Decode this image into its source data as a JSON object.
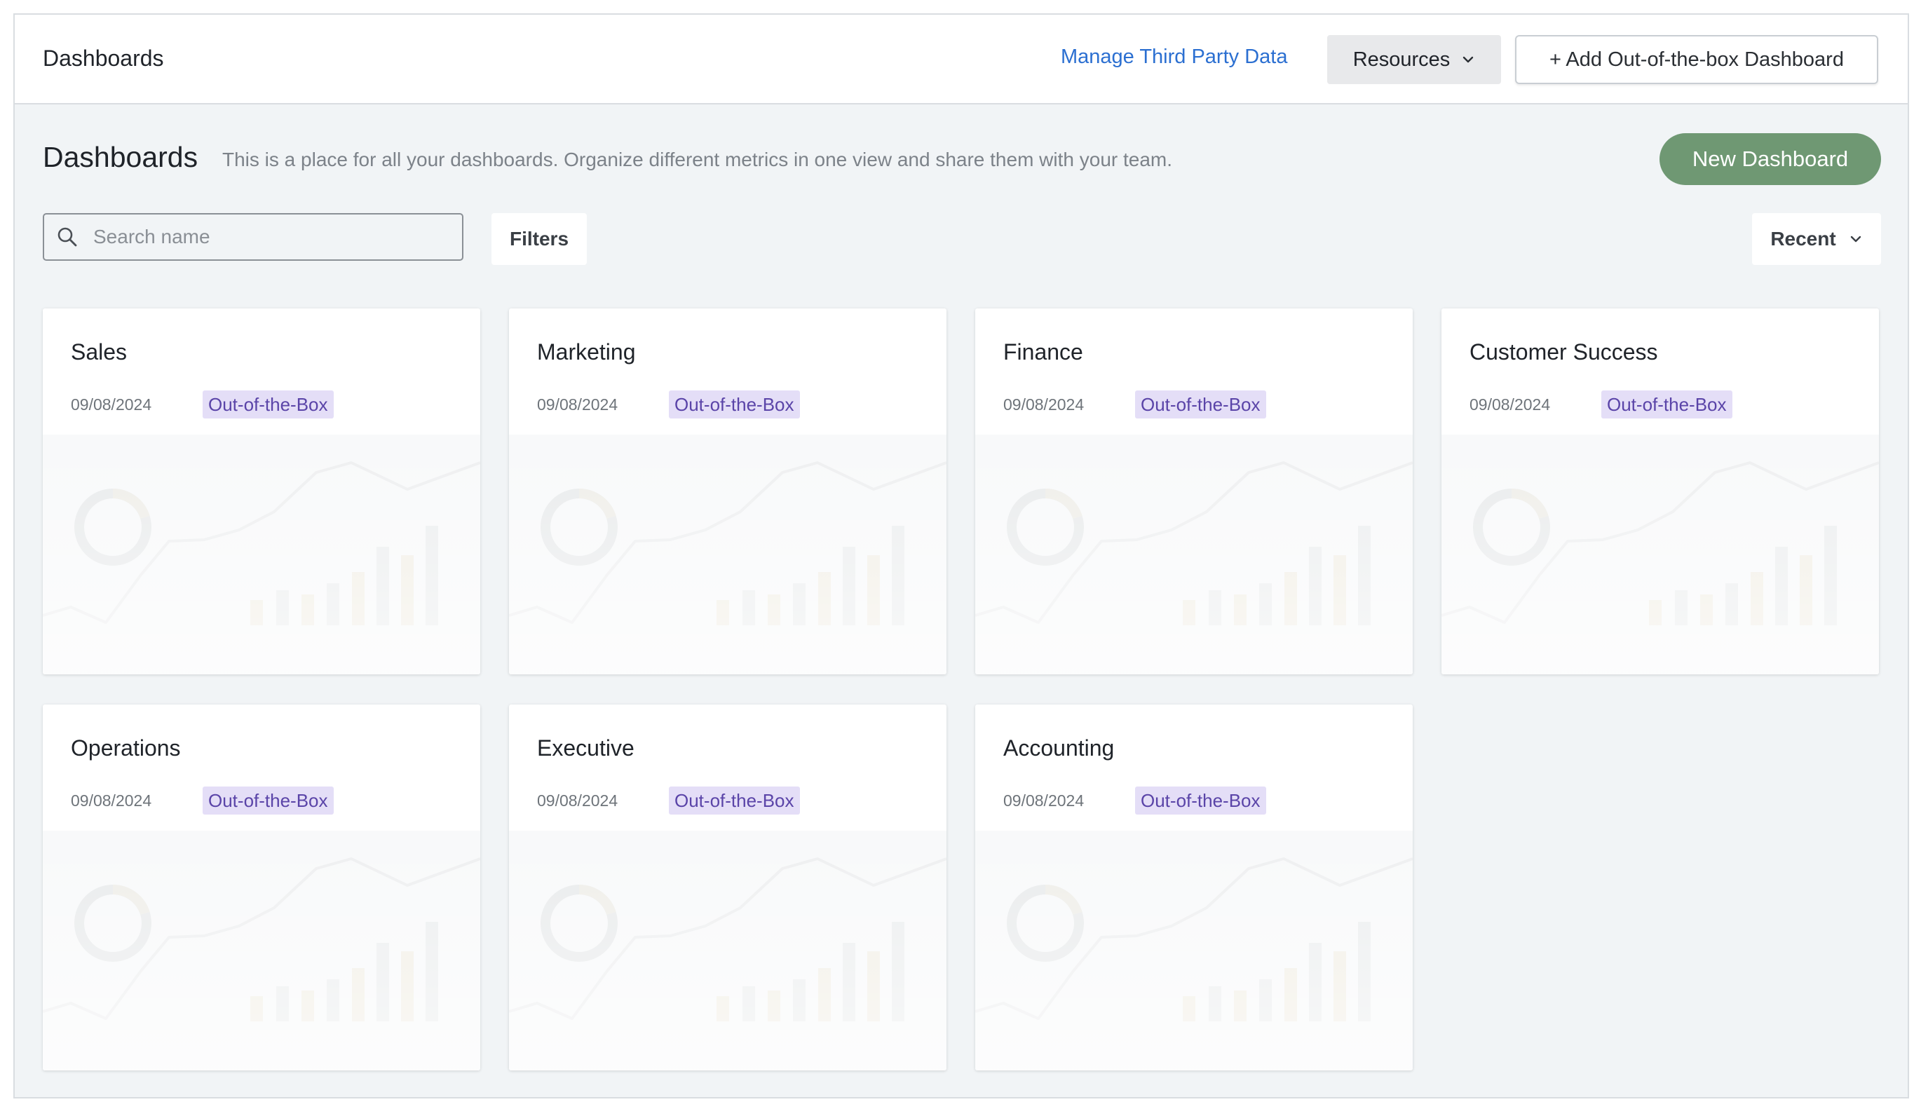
{
  "topbar": {
    "title": "Dashboards",
    "manage_link": "Manage Third Party Data",
    "resources_label": "Resources",
    "add_button_label": "+ Add Out-of-the-box Dashboard"
  },
  "page": {
    "title": "Dashboards",
    "description": "This is a place for all your dashboards. Organize different metrics in one view and share them with your team.",
    "new_button_label": "New Dashboard"
  },
  "toolbar": {
    "search_placeholder": "Search name",
    "filters_label": "Filters",
    "sort_label": "Recent"
  },
  "icons": {
    "search": "search-icon",
    "chevron": "chevron-down-icon"
  },
  "colors": {
    "accent_green": "#6f9873",
    "link_blue": "#2b6fd1",
    "badge_bg": "#e4def7",
    "badge_text": "#5a44a8"
  },
  "dashboards": [
    {
      "title": "Sales",
      "date": "09/08/2024",
      "badge": "Out-of-the-Box"
    },
    {
      "title": "Marketing",
      "date": "09/08/2024",
      "badge": "Out-of-the-Box"
    },
    {
      "title": "Finance",
      "date": "09/08/2024",
      "badge": "Out-of-the-Box"
    },
    {
      "title": "Customer Success",
      "date": "09/08/2024",
      "badge": "Out-of-the-Box"
    },
    {
      "title": "Operations",
      "date": "09/08/2024",
      "badge": "Out-of-the-Box"
    },
    {
      "title": "Executive",
      "date": "09/08/2024",
      "badge": "Out-of-the-Box"
    },
    {
      "title": "Accounting",
      "date": "09/08/2024",
      "badge": "Out-of-the-Box"
    }
  ]
}
